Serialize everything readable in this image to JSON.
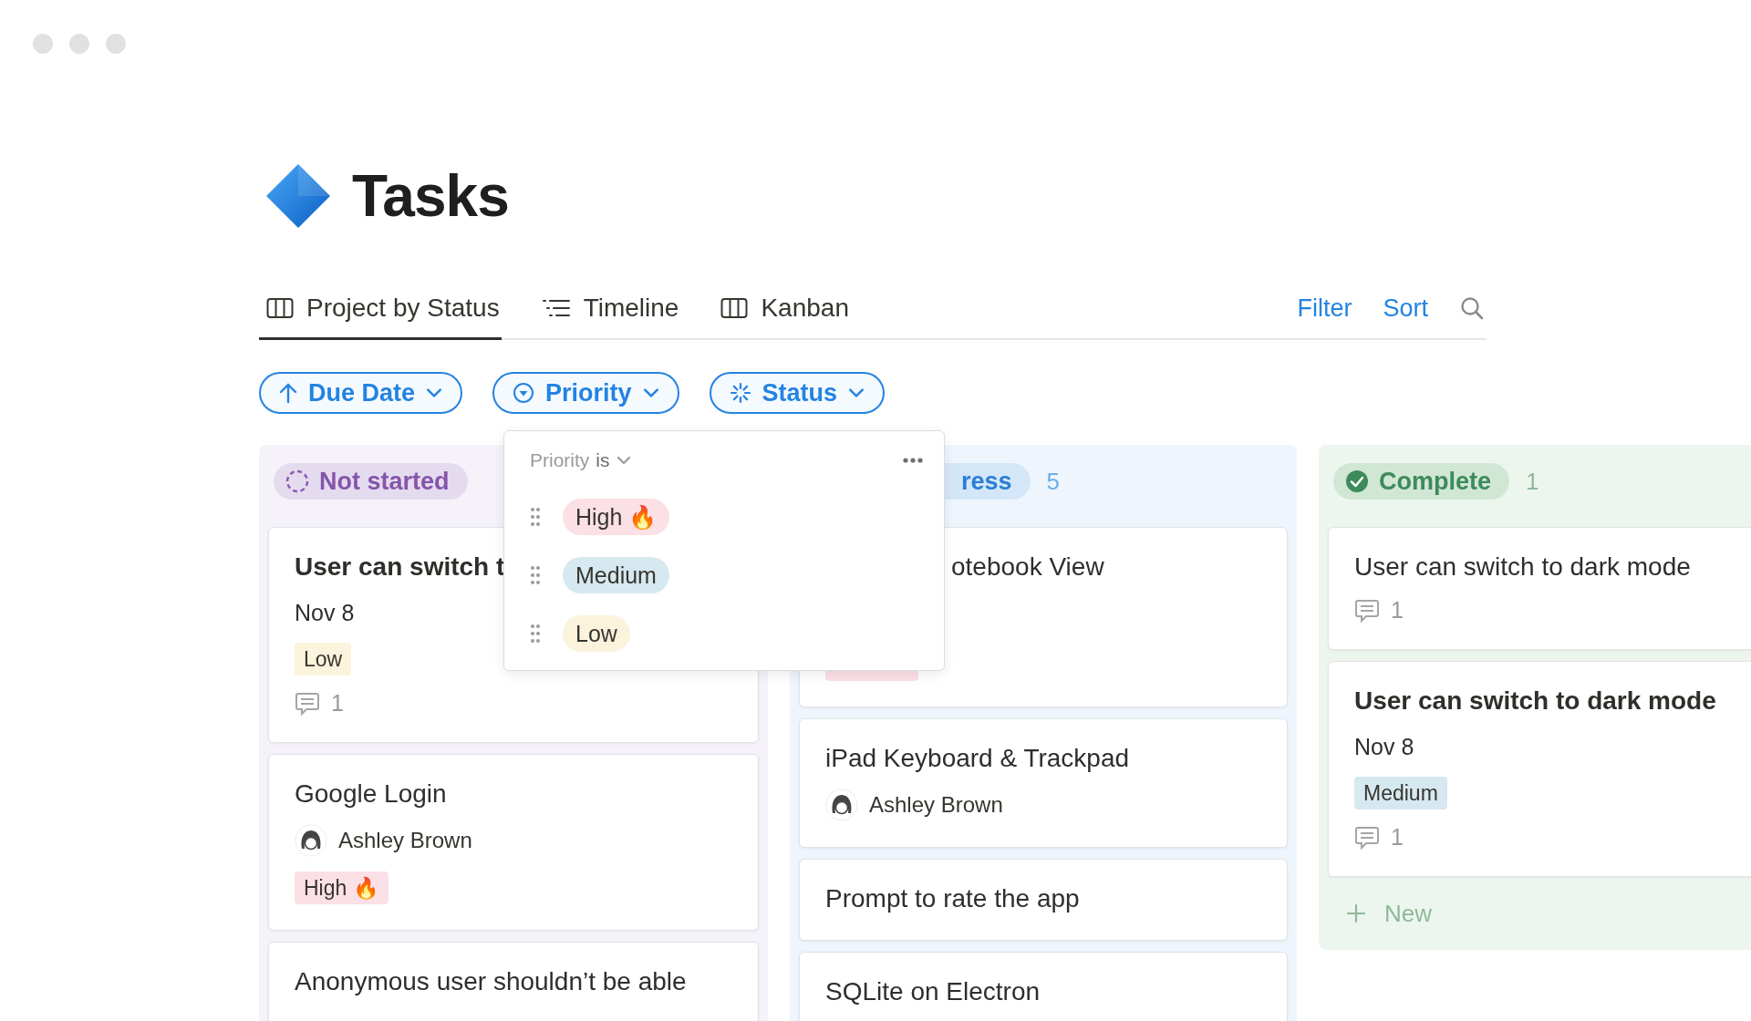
{
  "page": {
    "title": "Tasks"
  },
  "tabs": [
    {
      "label": "Project by Status",
      "kind": "columns",
      "selected": true
    },
    {
      "label": "Timeline",
      "kind": "list",
      "selected": false
    },
    {
      "label": "Kanban",
      "kind": "columns",
      "selected": false
    }
  ],
  "actions": [
    "Filter",
    "Sort"
  ],
  "filters": [
    {
      "label": "Due Date",
      "kind": "sort"
    },
    {
      "label": "Priority",
      "kind": "select"
    },
    {
      "label": "Status",
      "kind": "status"
    }
  ],
  "dropdown": {
    "field": "Priority",
    "operator": "is",
    "options": [
      {
        "label": "High 🔥",
        "color": "#fbe0e6"
      },
      {
        "label": "Medium",
        "color": "#d6e8f0"
      },
      {
        "label": "Low",
        "color": "#fcf3dc"
      }
    ]
  },
  "columns": [
    {
      "kind": "not_started",
      "label": "Not started",
      "cards": [
        {
          "title": "User can switch t",
          "date": "Nov 8",
          "tag": {
            "label": "Low",
            "color": "#fcf3dc"
          },
          "comments": "1"
        },
        {
          "title": "Google Login",
          "assignee": "Ashley Brown",
          "tag": {
            "label": "High 🔥",
            "color": "#fbe0e6"
          }
        },
        {
          "title": "Anonymous user shouldn’t be able"
        }
      ]
    },
    {
      "kind": "in_progress",
      "label": "ress",
      "count": "5",
      "cards": [
        {
          "title": "otebook View",
          "tag": {
            "color": "#fbe0e6"
          }
        },
        {
          "title": "iPad Keyboard & Trackpad",
          "assignee": "Ashley Brown"
        },
        {
          "title": "Prompt to rate the app"
        },
        {
          "title": "SQLite on Electron"
        }
      ]
    },
    {
      "kind": "complete",
      "label": "Complete",
      "count": "1",
      "add": "New",
      "cards": [
        {
          "title": "User can switch to dark mode",
          "comments": "1"
        },
        {
          "title": "User can switch to dark mode",
          "date": "Nov 8",
          "tag": {
            "label": "Medium",
            "color": "#d6e8f0"
          },
          "comments": "1"
        }
      ]
    }
  ]
}
